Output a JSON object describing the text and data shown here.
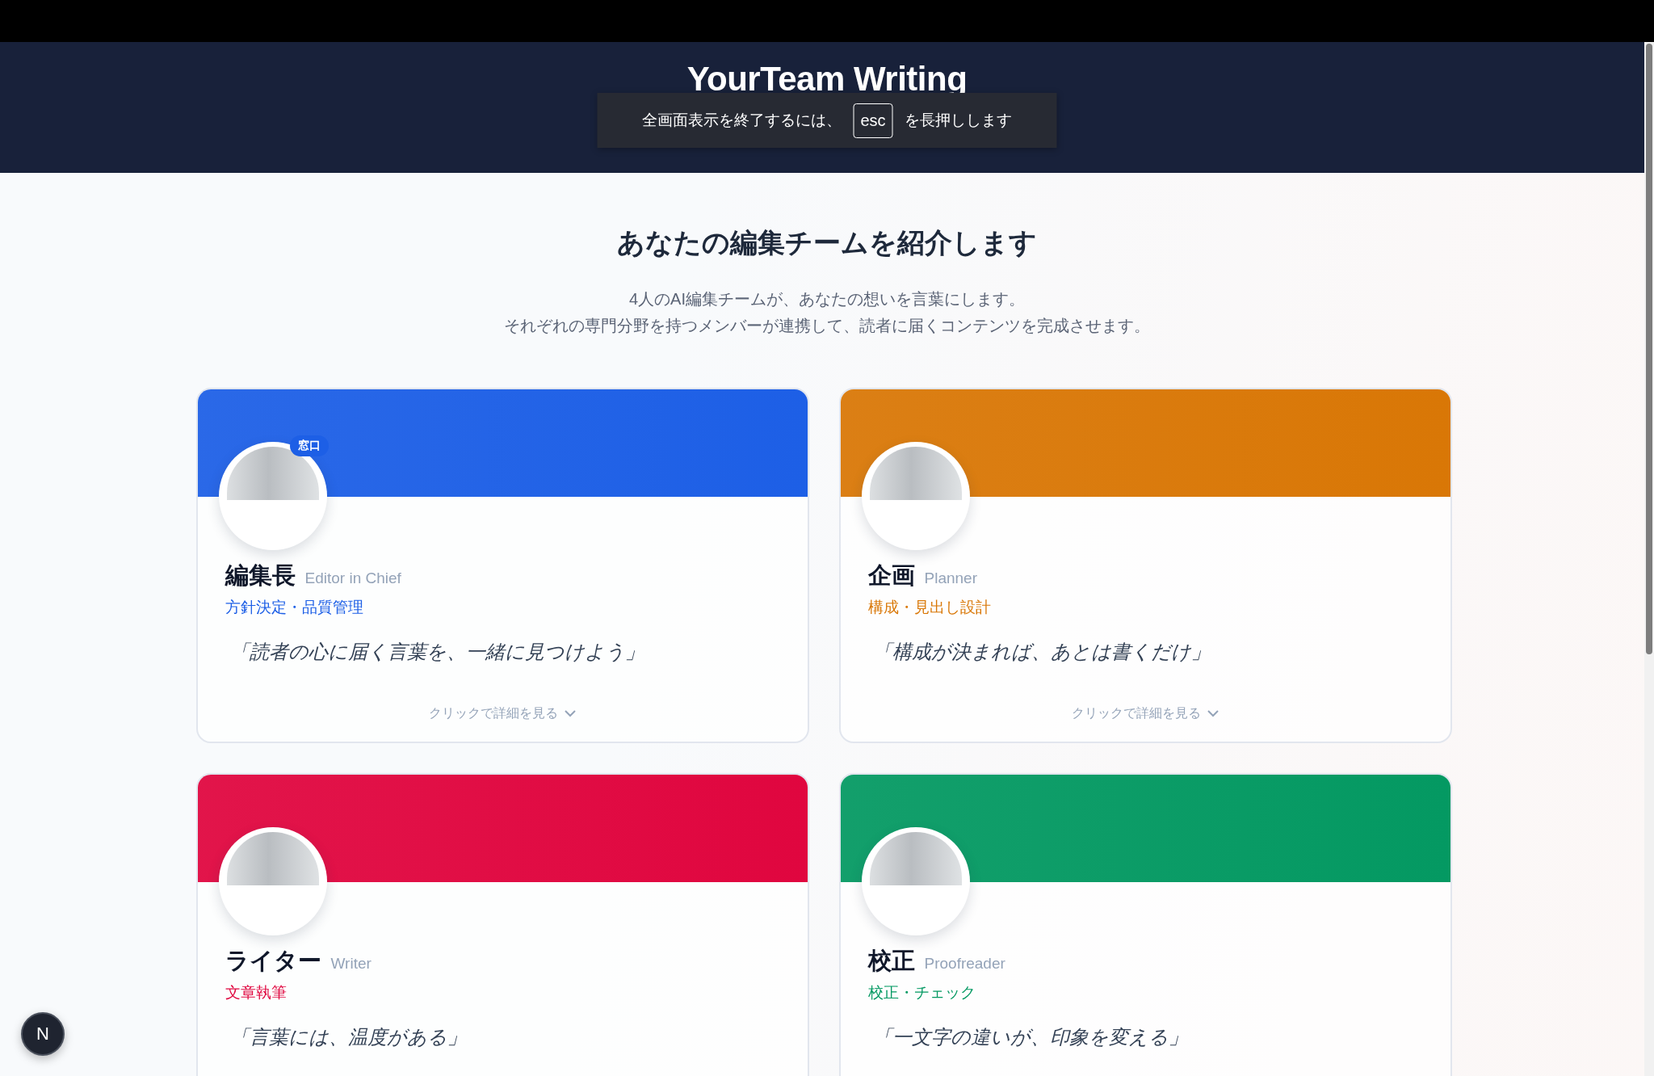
{
  "fullscreen_notice": {
    "text_before": "全画面表示を終了するには、",
    "key": "esc",
    "text_after": "を長押しします"
  },
  "header": {
    "title": "YourTeam Writing"
  },
  "intro": {
    "heading": "あなたの編集チームを紹介します",
    "lines": [
      "4人のAI編集チームが、あなたの想いを言葉にします。",
      "それぞれの専門分野を持つメンバーが連携して、読者に届くコンテンツを完成させます。"
    ]
  },
  "members": [
    {
      "name": "編集長",
      "english": "Editor in Chief",
      "role": "方針決定・品質管理",
      "quote": "「読者の心に届く言葉を、一緒に見つけよう」",
      "badge": "窓口",
      "details_link": "クリックで詳細を見る",
      "color": "#1d5fe6"
    },
    {
      "name": "企画",
      "english": "Planner",
      "role": "構成・見出し設計",
      "quote": "「構成が決まれば、あとは書くだけ」",
      "details_link": "クリックで詳細を見る",
      "color": "#d97706"
    },
    {
      "name": "ライター",
      "english": "Writer",
      "role": "文章執筆",
      "quote": "「言葉には、温度がある」",
      "color": "#e0063f"
    },
    {
      "name": "校正",
      "english": "Proofreader",
      "role": "校正・チェック",
      "quote": "「一文字の違いが、印象を変える」",
      "color": "#049962"
    }
  ],
  "dev_button": {
    "label": "N"
  }
}
